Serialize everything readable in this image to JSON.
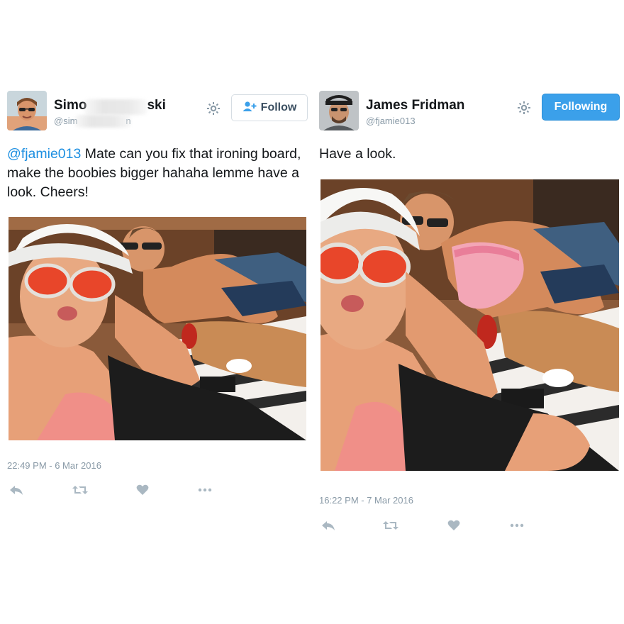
{
  "tweets": [
    {
      "display_name_visible": "Simo",
      "display_name_suffix": "ski",
      "handle": "@sim",
      "handle_suffix": "n",
      "follow_button": {
        "label": "Follow",
        "state": "not-following"
      },
      "text": {
        "mention": "@fjamie013",
        "body": "Mate can you fix that ironing board, make the boobies bigger hahaha lemme have a look. Cheers!"
      },
      "timestamp": "22:49 PM - 6 Mar 2016",
      "icons": [
        "reply-icon",
        "retweet-icon",
        "heart-icon",
        "more-icon"
      ]
    },
    {
      "display_name": "James Fridman",
      "handle": "@fjamie013",
      "follow_button": {
        "label": "Following",
        "state": "following"
      },
      "text": {
        "body": "Have a look."
      },
      "timestamp": "16:22 PM - 7 Mar 2016",
      "icons": [
        "reply-icon",
        "retweet-icon",
        "heart-icon",
        "more-icon"
      ]
    }
  ],
  "colors": {
    "link": "#1d8fe1",
    "following_button": "#3ba0ea",
    "muted_text": "#8899a6",
    "action_icon": "#aab8c2"
  }
}
